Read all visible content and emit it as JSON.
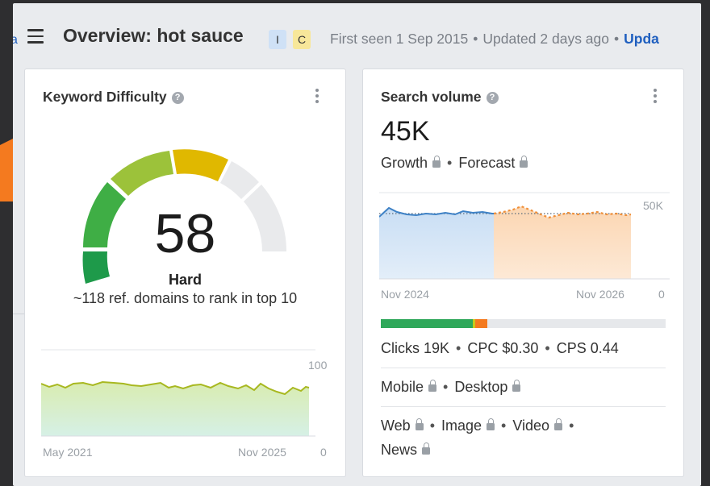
{
  "header": {
    "edge_link_fragment": "a",
    "title": "Overview: hot sauce",
    "intent_badges": [
      "I",
      "C"
    ],
    "first_seen": "First seen 1 Sep 2015",
    "updated": "Updated 2 days ago",
    "update_link": "Upda"
  },
  "keyword_difficulty": {
    "title": "Keyword Difficulty",
    "value": "58",
    "rating": "Hard",
    "subtitle": "~118 ref. domains to rank in top 10",
    "history_chart": {
      "type": "area",
      "y_max_label": "100",
      "y_min_label": "0",
      "x_start_label": "May 2021",
      "x_end_label": "Nov 2025"
    }
  },
  "search_volume": {
    "title": "Search volume",
    "value": "45K",
    "growth_label": "Growth",
    "forecast_label": "Forecast",
    "volume_chart": {
      "type": "area",
      "y_max_label": "50K",
      "y_min_label": "0",
      "x_start_label": "Nov 2024",
      "x_end_label": "Nov 2026"
    },
    "clicks": "Clicks 19K",
    "cpc": "CPC $0.30",
    "cps": "CPS 0.44",
    "devices": [
      "Mobile",
      "Desktop"
    ],
    "sources": [
      "Web",
      "Image",
      "Video",
      "News"
    ]
  },
  "colors": {
    "accent_link": "#1f5fbf",
    "gauge_green": "#2fa85a",
    "gauge_yellow": "#e0b800",
    "history_line": "#a8b820",
    "volume_blue": "#3f82c6",
    "forecast_orange": "#f0903a",
    "arrow_orange": "#f47a1f"
  }
}
